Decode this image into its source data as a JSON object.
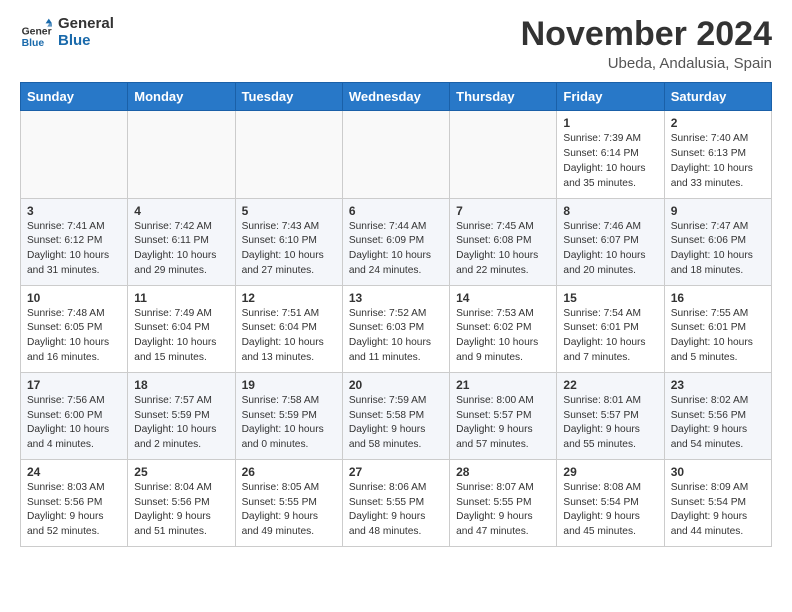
{
  "header": {
    "logo_general": "General",
    "logo_blue": "Blue",
    "month_title": "November 2024",
    "location": "Ubeda, Andalusia, Spain"
  },
  "columns": [
    "Sunday",
    "Monday",
    "Tuesday",
    "Wednesday",
    "Thursday",
    "Friday",
    "Saturday"
  ],
  "weeks": [
    [
      {
        "day": "",
        "info": ""
      },
      {
        "day": "",
        "info": ""
      },
      {
        "day": "",
        "info": ""
      },
      {
        "day": "",
        "info": ""
      },
      {
        "day": "",
        "info": ""
      },
      {
        "day": "1",
        "info": "Sunrise: 7:39 AM\nSunset: 6:14 PM\nDaylight: 10 hours and 35 minutes."
      },
      {
        "day": "2",
        "info": "Sunrise: 7:40 AM\nSunset: 6:13 PM\nDaylight: 10 hours and 33 minutes."
      }
    ],
    [
      {
        "day": "3",
        "info": "Sunrise: 7:41 AM\nSunset: 6:12 PM\nDaylight: 10 hours and 31 minutes."
      },
      {
        "day": "4",
        "info": "Sunrise: 7:42 AM\nSunset: 6:11 PM\nDaylight: 10 hours and 29 minutes."
      },
      {
        "day": "5",
        "info": "Sunrise: 7:43 AM\nSunset: 6:10 PM\nDaylight: 10 hours and 27 minutes."
      },
      {
        "day": "6",
        "info": "Sunrise: 7:44 AM\nSunset: 6:09 PM\nDaylight: 10 hours and 24 minutes."
      },
      {
        "day": "7",
        "info": "Sunrise: 7:45 AM\nSunset: 6:08 PM\nDaylight: 10 hours and 22 minutes."
      },
      {
        "day": "8",
        "info": "Sunrise: 7:46 AM\nSunset: 6:07 PM\nDaylight: 10 hours and 20 minutes."
      },
      {
        "day": "9",
        "info": "Sunrise: 7:47 AM\nSunset: 6:06 PM\nDaylight: 10 hours and 18 minutes."
      }
    ],
    [
      {
        "day": "10",
        "info": "Sunrise: 7:48 AM\nSunset: 6:05 PM\nDaylight: 10 hours and 16 minutes."
      },
      {
        "day": "11",
        "info": "Sunrise: 7:49 AM\nSunset: 6:04 PM\nDaylight: 10 hours and 15 minutes."
      },
      {
        "day": "12",
        "info": "Sunrise: 7:51 AM\nSunset: 6:04 PM\nDaylight: 10 hours and 13 minutes."
      },
      {
        "day": "13",
        "info": "Sunrise: 7:52 AM\nSunset: 6:03 PM\nDaylight: 10 hours and 11 minutes."
      },
      {
        "day": "14",
        "info": "Sunrise: 7:53 AM\nSunset: 6:02 PM\nDaylight: 10 hours and 9 minutes."
      },
      {
        "day": "15",
        "info": "Sunrise: 7:54 AM\nSunset: 6:01 PM\nDaylight: 10 hours and 7 minutes."
      },
      {
        "day": "16",
        "info": "Sunrise: 7:55 AM\nSunset: 6:01 PM\nDaylight: 10 hours and 5 minutes."
      }
    ],
    [
      {
        "day": "17",
        "info": "Sunrise: 7:56 AM\nSunset: 6:00 PM\nDaylight: 10 hours and 4 minutes."
      },
      {
        "day": "18",
        "info": "Sunrise: 7:57 AM\nSunset: 5:59 PM\nDaylight: 10 hours and 2 minutes."
      },
      {
        "day": "19",
        "info": "Sunrise: 7:58 AM\nSunset: 5:59 PM\nDaylight: 10 hours and 0 minutes."
      },
      {
        "day": "20",
        "info": "Sunrise: 7:59 AM\nSunset: 5:58 PM\nDaylight: 9 hours and 58 minutes."
      },
      {
        "day": "21",
        "info": "Sunrise: 8:00 AM\nSunset: 5:57 PM\nDaylight: 9 hours and 57 minutes."
      },
      {
        "day": "22",
        "info": "Sunrise: 8:01 AM\nSunset: 5:57 PM\nDaylight: 9 hours and 55 minutes."
      },
      {
        "day": "23",
        "info": "Sunrise: 8:02 AM\nSunset: 5:56 PM\nDaylight: 9 hours and 54 minutes."
      }
    ],
    [
      {
        "day": "24",
        "info": "Sunrise: 8:03 AM\nSunset: 5:56 PM\nDaylight: 9 hours and 52 minutes."
      },
      {
        "day": "25",
        "info": "Sunrise: 8:04 AM\nSunset: 5:56 PM\nDaylight: 9 hours and 51 minutes."
      },
      {
        "day": "26",
        "info": "Sunrise: 8:05 AM\nSunset: 5:55 PM\nDaylight: 9 hours and 49 minutes."
      },
      {
        "day": "27",
        "info": "Sunrise: 8:06 AM\nSunset: 5:55 PM\nDaylight: 9 hours and 48 minutes."
      },
      {
        "day": "28",
        "info": "Sunrise: 8:07 AM\nSunset: 5:55 PM\nDaylight: 9 hours and 47 minutes."
      },
      {
        "day": "29",
        "info": "Sunrise: 8:08 AM\nSunset: 5:54 PM\nDaylight: 9 hours and 45 minutes."
      },
      {
        "day": "30",
        "info": "Sunrise: 8:09 AM\nSunset: 5:54 PM\nDaylight: 9 hours and 44 minutes."
      }
    ]
  ]
}
